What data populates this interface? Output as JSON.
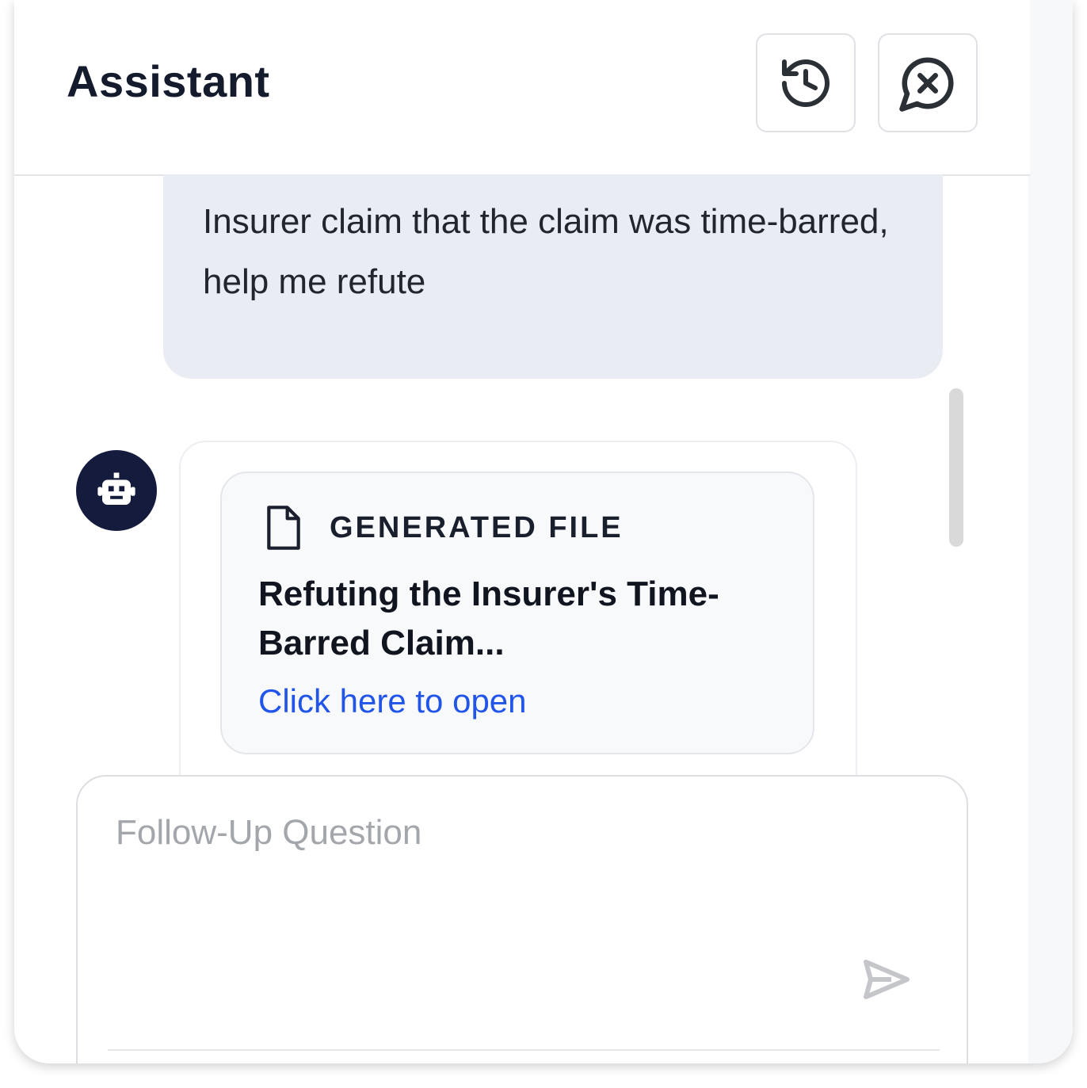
{
  "header": {
    "title": "Assistant",
    "history_icon": "history-icon",
    "close_icon": "close-chat-icon"
  },
  "user_message": {
    "text": "Insurer claim that the claim was time-barred, help me refute"
  },
  "assistant_message": {
    "avatar_icon": "robot-icon",
    "file_card": {
      "icon": "file-icon",
      "label": "GENERATED FILE",
      "file_name": "Refuting the Insurer's Time-Barred Claim...",
      "link_text": "Click here to open"
    }
  },
  "composer": {
    "placeholder": "Follow-Up Question",
    "value": "",
    "send_icon": "send-icon"
  },
  "colors": {
    "title": "#141b2d",
    "user_bubble_bg": "#e9ecf2",
    "avatar_bg": "#151b3d",
    "link": "#2154e8",
    "placeholder": "#a3a6ab"
  }
}
